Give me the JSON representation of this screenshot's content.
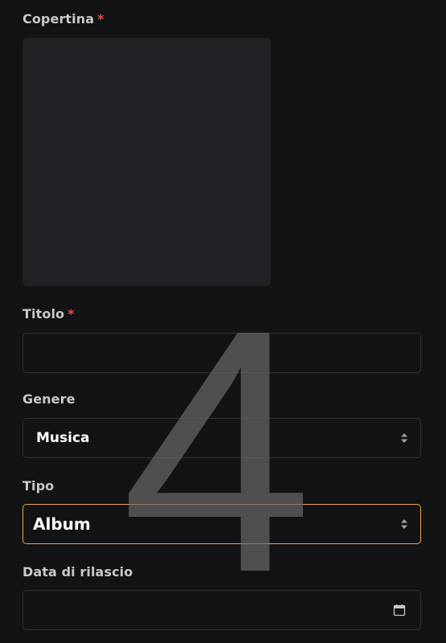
{
  "form": {
    "cover": {
      "label": "Copertina",
      "required_mark": "*"
    },
    "title": {
      "label": "Titolo",
      "required_mark": "*",
      "value": ""
    },
    "genre": {
      "label": "Genere",
      "value": "Musica"
    },
    "type": {
      "label": "Tipo",
      "value": "Album"
    },
    "release_date": {
      "label": "Data di rilascio",
      "value": ""
    }
  },
  "overlay": {
    "text": "4"
  },
  "icons": {
    "select_arrow": "select-arrows-icon",
    "calendar": "calendar-icon"
  },
  "colors": {
    "background": "#111315",
    "cover_placeholder": "#1f2125",
    "label": "#c6c8cc",
    "required": "#e5484d",
    "field_border": "#2e3137",
    "focus_border": "#f0a64a",
    "overlay_digit": "#5a5a5a"
  }
}
